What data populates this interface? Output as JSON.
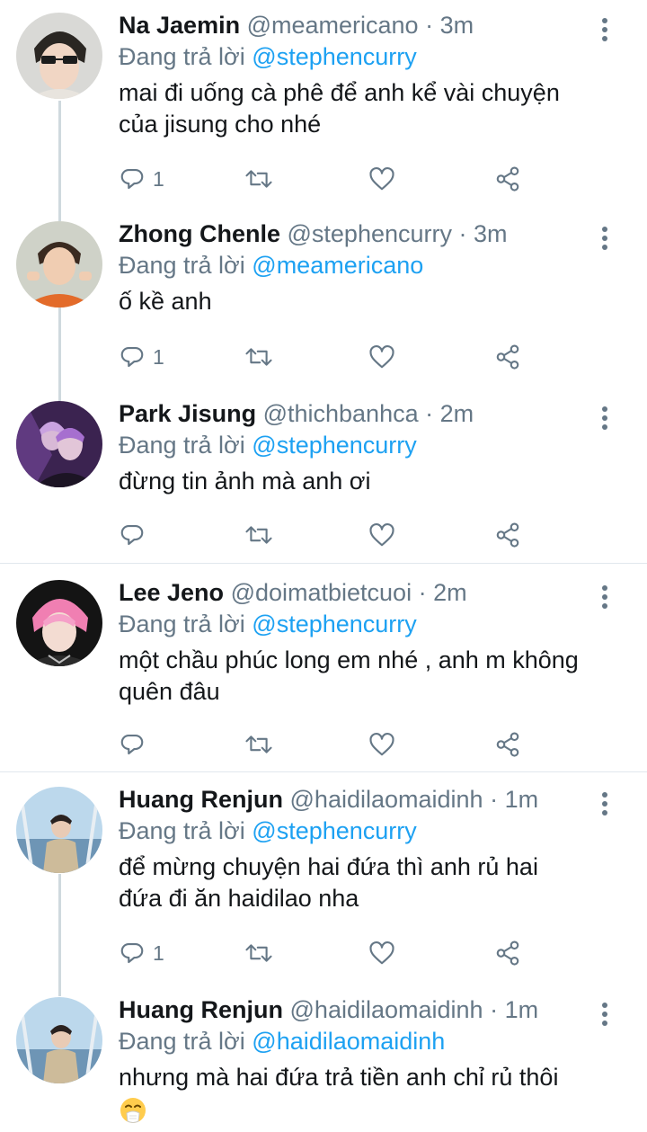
{
  "reply_prefix": "Đang trả lời",
  "tweets": [
    {
      "name": "Na Jaemin",
      "handle": "@meamericano",
      "dot": "·",
      "time": "3m",
      "reply_to": "@stephencurry",
      "text_lines": [
        "mai đi uống cà phê để anh kể vài chuyện",
        "của jisung cho nhé"
      ],
      "reply_count": "1"
    },
    {
      "name": "Zhong Chenle",
      "handle": "@stephencurry",
      "dot": "·",
      "time": "3m",
      "reply_to": "@meamericano",
      "text_lines": [
        "ố kề anh"
      ],
      "reply_count": "1"
    },
    {
      "name": "Park Jisung",
      "handle": "@thichbanhca",
      "dot": "·",
      "time": "2m",
      "reply_to": "@stephencurry",
      "text_lines": [
        "đừng tin ảnh mà anh ơi"
      ],
      "reply_count": ""
    },
    {
      "name": "Lee Jeno",
      "handle": "@doimatbietcuoi",
      "dot": "·",
      "time": "2m",
      "reply_to": "@stephencurry",
      "text_lines": [
        "một chầu phúc long em nhé , anh m không",
        "quên đâu"
      ],
      "reply_count": ""
    },
    {
      "name": "Huang Renjun",
      "handle": "@haidilaomaidinh",
      "dot": "·",
      "time": "1m",
      "reply_to": "@stephencurry",
      "text_lines": [
        "để mừng chuyện hai đứa thì anh rủ hai",
        "đứa đi ăn haidilao nha"
      ],
      "reply_count": "1"
    },
    {
      "name": "Huang Renjun",
      "handle": "@haidilaomaidinh",
      "dot": "·",
      "time": "1m",
      "reply_to": "@haidilaomaidinh",
      "text_lines": [
        "nhưng mà hai đứa trả tiền anh chỉ rủ thôi"
      ],
      "reply_count": ""
    }
  ],
  "icons": {
    "reply": "reply-icon",
    "retweet": "retweet-icon",
    "like": "heart-icon",
    "share": "share-icon",
    "more": "more-vertical-icon",
    "emoji": "sneezing-face-emoji"
  },
  "colors": {
    "link": "#1da1f2",
    "secondary_text": "#657786",
    "thread_line": "#cfd9de",
    "separator": "#e1e8ed"
  }
}
